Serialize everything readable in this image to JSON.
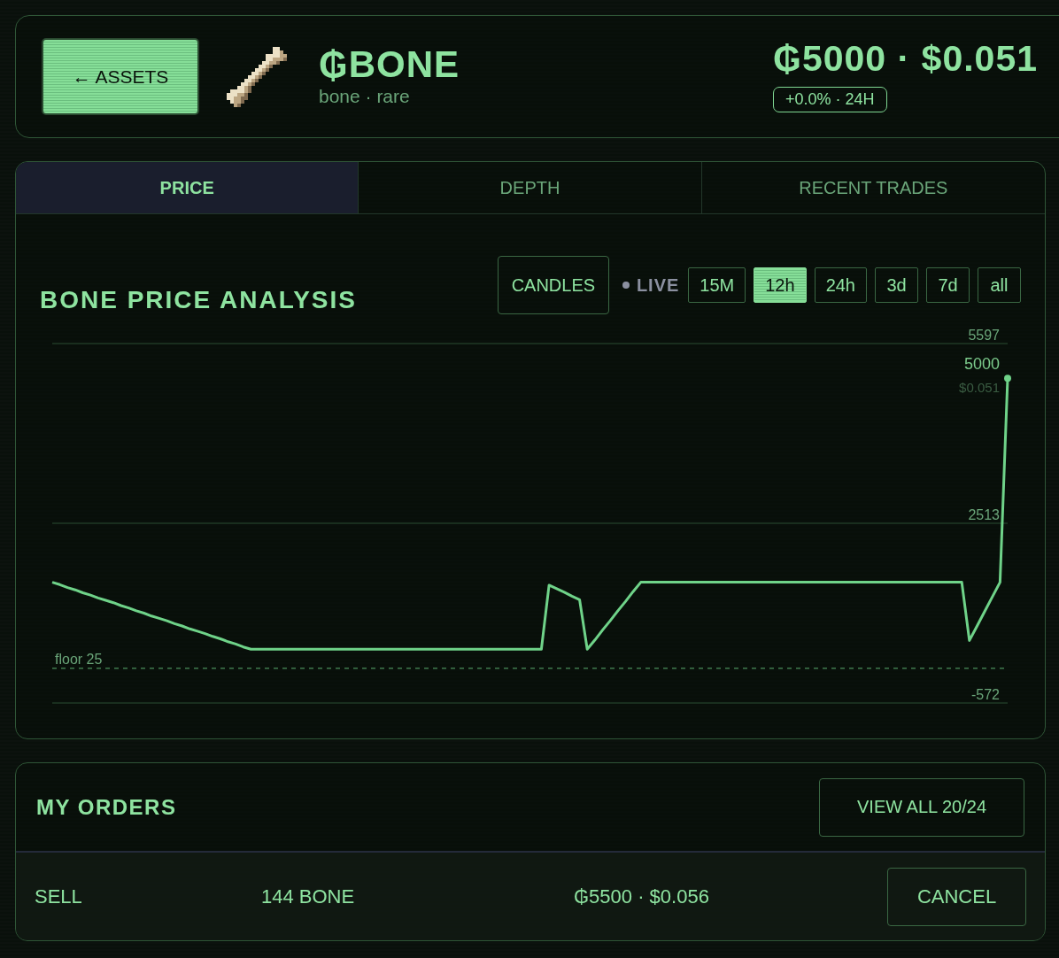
{
  "header": {
    "back_button": "← ASSETS",
    "token": {
      "symbol": "₲BONE",
      "subtitle": "bone · rare"
    },
    "price": "₲5000 · $0.051",
    "change_badge": "+0.0% · 24H"
  },
  "tabs": [
    {
      "label": "PRICE",
      "selected": true
    },
    {
      "label": "DEPTH",
      "selected": false
    },
    {
      "label": "RECENT TRADES",
      "selected": false
    }
  ],
  "price_panel": {
    "chart_style_button": "CANDLES",
    "live": {
      "label": "LIVE",
      "on": false
    },
    "timeframes": [
      {
        "label": "15M",
        "selected": false
      },
      {
        "label": "12h",
        "selected": true
      },
      {
        "label": "24h",
        "selected": false
      },
      {
        "label": "3d",
        "selected": false
      },
      {
        "label": "7d",
        "selected": false
      },
      {
        "label": "all",
        "selected": false
      }
    ],
    "last_point": {
      "price_label": "5000",
      "usd_label": "$0.051"
    },
    "chart_data": {
      "type": "line",
      "title": "BONE PRICE ANALYSIS",
      "categories": [
        null,
        null,
        null,
        null,
        null,
        null,
        null,
        null,
        null,
        null,
        null,
        null,
        null,
        null,
        null,
        null,
        null,
        null,
        null,
        null,
        null,
        null,
        null,
        null,
        null,
        null,
        null,
        null,
        null,
        null,
        null,
        null,
        null,
        null,
        null,
        null,
        null,
        null,
        null,
        null,
        null,
        null,
        null,
        null,
        null,
        null,
        null,
        null,
        null,
        null,
        null,
        null,
        null,
        null,
        null,
        null,
        null,
        null,
        null,
        null,
        null,
        null,
        null,
        null,
        null,
        null,
        null,
        null,
        null,
        null,
        null,
        null,
        null,
        null,
        null,
        null,
        null,
        null,
        null,
        null,
        null,
        null,
        null,
        null,
        null,
        null,
        null,
        null,
        null,
        null,
        null,
        null,
        null,
        null,
        null,
        null,
        null,
        null,
        null,
        null,
        null,
        null,
        null,
        null,
        null,
        null,
        null,
        null,
        null,
        null,
        null,
        null,
        null,
        null,
        null,
        null,
        null,
        null,
        null,
        null,
        null,
        null,
        null,
        null,
        null,
        null
      ],
      "series": [
        {
          "color": "#6fd389",
          "values": [
            1500,
            1460,
            1410,
            1370,
            1320,
            1280,
            1230,
            1190,
            1150,
            1100,
            1060,
            1010,
            970,
            920,
            880,
            840,
            790,
            750,
            700,
            660,
            620,
            570,
            530,
            480,
            440,
            390,
            350,
            350,
            350,
            350,
            350,
            350,
            350,
            350,
            350,
            350,
            350,
            350,
            350,
            350,
            350,
            350,
            350,
            350,
            350,
            350,
            350,
            350,
            350,
            350,
            350,
            350,
            350,
            350,
            350,
            350,
            350,
            350,
            350,
            350,
            350,
            350,
            350,
            350,
            350,
            1450,
            1390,
            1330,
            1260,
            1200,
            350,
            510,
            680,
            840,
            1010,
            1170,
            1340,
            1500,
            1500,
            1500,
            1500,
            1500,
            1500,
            1500,
            1500,
            1500,
            1500,
            1500,
            1500,
            1500,
            1500,
            1500,
            1500,
            1500,
            1500,
            1500,
            1500,
            1500,
            1500,
            1500,
            1500,
            1500,
            1500,
            1500,
            1500,
            1500,
            1500,
            1500,
            1500,
            1500,
            1500,
            1500,
            1500,
            1500,
            1500,
            1500,
            1500,
            1500,
            1500,
            1500,
            500,
            750,
            1000,
            1250,
            1500,
            5000
          ]
        }
      ],
      "ylim": [
        -572,
        5597
      ],
      "yticks": [
        5597,
        2513,
        -572
      ],
      "ref_lines": [
        {
          "axis": "y",
          "value": 25,
          "label": "floor 25"
        }
      ]
    }
  },
  "orders": {
    "title": "MY ORDERS",
    "view_all_button": "VIEW ALL 20/24",
    "rows": [
      {
        "side": "SELL",
        "amount": "144 BONE",
        "price": "₲5500 · $0.056",
        "action": "CANCEL"
      }
    ]
  }
}
